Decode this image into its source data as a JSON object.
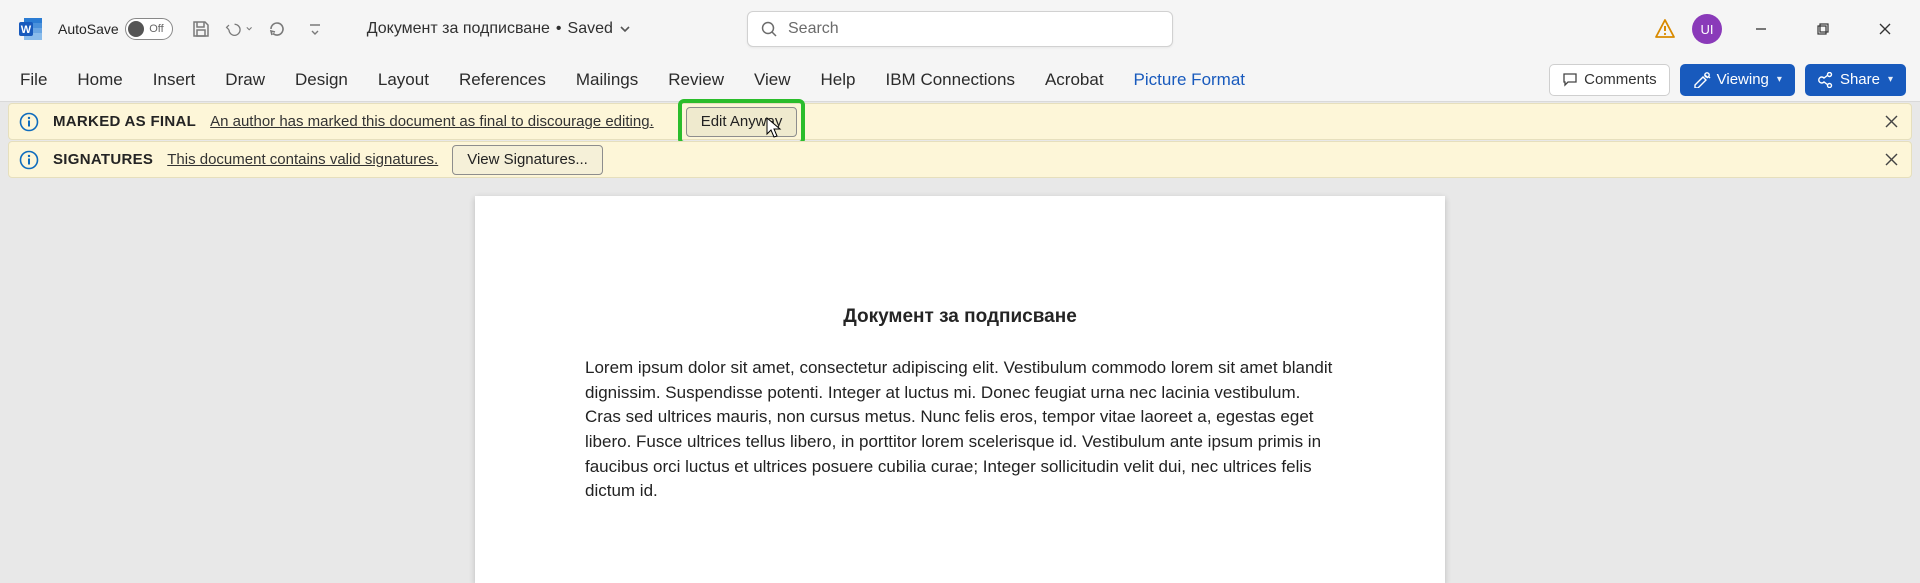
{
  "title_bar": {
    "autosave_label": "AutoSave",
    "autosave_state": "Off",
    "doc_name": "Документ за подписване",
    "saved_state": "Saved",
    "search_placeholder": "Search",
    "avatar_initials": "UI"
  },
  "ribbon": {
    "tabs": [
      "File",
      "Home",
      "Insert",
      "Draw",
      "Design",
      "Layout",
      "References",
      "Mailings",
      "Review",
      "View",
      "Help",
      "IBM Connections",
      "Acrobat",
      "Picture Format"
    ],
    "active_tab": "Picture Format",
    "comments": "Comments",
    "viewing": "Viewing",
    "share": "Share"
  },
  "infobars": {
    "final": {
      "title": "MARKED AS FINAL",
      "msg": "An author has marked this document as final to discourage editing.",
      "action": "Edit Anyway"
    },
    "signatures": {
      "title": "SIGNATURES",
      "msg": "This document contains valid signatures.",
      "action": "View Signatures..."
    }
  },
  "document": {
    "heading": "Документ за подписване",
    "body": "Lorem ipsum dolor sit amet, consectetur adipiscing elit. Vestibulum commodo lorem sit amet blandit dignissim. Suspendisse potenti. Integer at luctus mi. Donec feugiat urna nec lacinia vestibulum. Cras sed ultrices mauris, non cursus metus. Nunc felis eros, tempor vitae laoreet a, egestas eget libero. Fusce ultrices tellus libero, in porttitor lorem scelerisque id. Vestibulum ante ipsum primis in faucibus orci luctus et ultrices posuere cubilia curae; Integer sollicitudin velit dui, nec ultrices felis dictum id."
  }
}
